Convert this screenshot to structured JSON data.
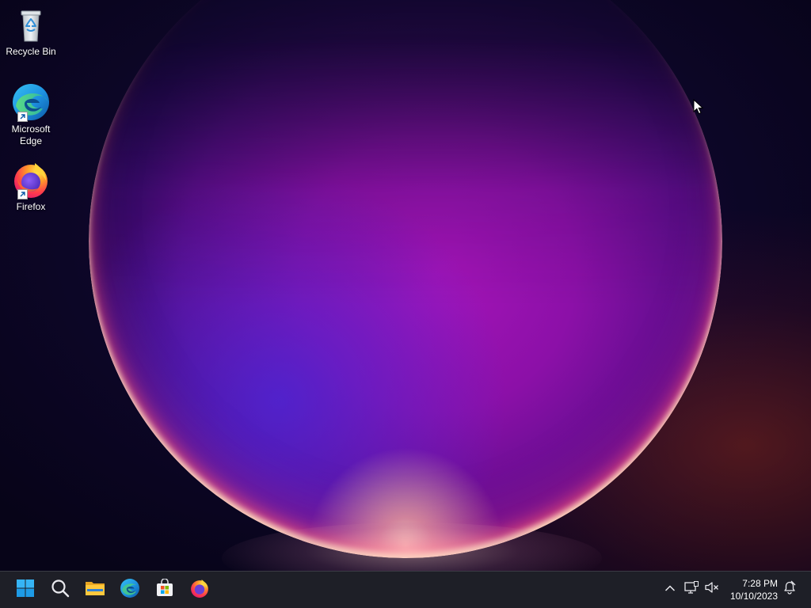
{
  "desktop": {
    "icons": [
      {
        "label": "Recycle Bin",
        "icon": "recycle-bin-icon"
      },
      {
        "label": "Microsoft Edge",
        "icon": "edge-icon",
        "shortcut": true
      },
      {
        "label": "Firefox",
        "icon": "firefox-icon",
        "shortcut": true
      }
    ]
  },
  "taskbar": {
    "pinned": [
      {
        "name": "start",
        "icon": "windows-logo-icon"
      },
      {
        "name": "search",
        "icon": "search-icon"
      },
      {
        "name": "file-explorer",
        "icon": "folder-icon"
      },
      {
        "name": "edge",
        "icon": "edge-icon"
      },
      {
        "name": "microsoft-store",
        "icon": "store-icon"
      },
      {
        "name": "firefox",
        "icon": "firefox-icon"
      }
    ],
    "tray": {
      "icons": [
        "chevron-up-icon",
        "network-icon",
        "speaker-muted-icon",
        "notification-icon"
      ],
      "time": "7:28 PM",
      "date": "10/10/2023"
    }
  },
  "colors": {
    "taskbar_bg": "#1e1f27",
    "accent_blue": "#0078d4"
  }
}
